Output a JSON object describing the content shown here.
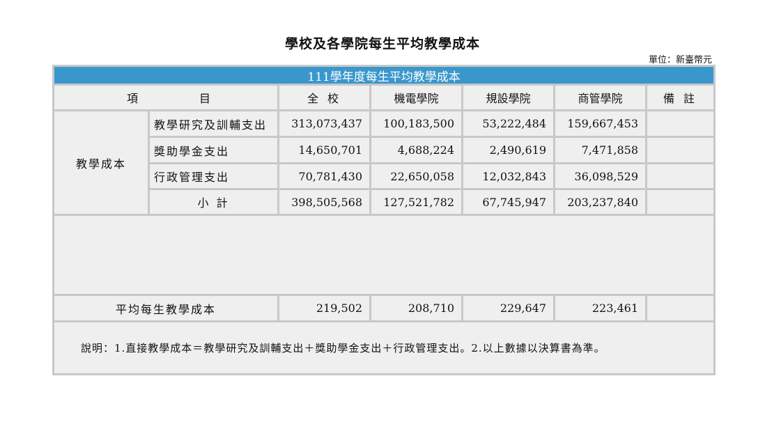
{
  "title": "學校及各學院每生平均教學成本",
  "unit": "單位：新臺幣元",
  "banner": "111學年度每生平均教學成本",
  "headers": {
    "item_left": "項",
    "item_right": "目",
    "school": "全 校",
    "college1": "機電學院",
    "college2": "規設學院",
    "college3": "商管學院",
    "remark": "備 註"
  },
  "group_label": "教學成本",
  "rows": [
    {
      "label": "教學研究及訓輔支出",
      "school": "313,073,437",
      "c1": "100,183,500",
      "c2": "53,222,484",
      "c3": "159,667,453",
      "remark": ""
    },
    {
      "label": "獎助學金支出",
      "school": "14,650,701",
      "c1": "4,688,224",
      "c2": "2,490,619",
      "c3": "7,471,858",
      "remark": ""
    },
    {
      "label": "行政管理支出",
      "school": "70,781,430",
      "c1": "22,650,058",
      "c2": "12,032,843",
      "c3": "36,098,529",
      "remark": ""
    },
    {
      "label": "小 計",
      "school": "398,505,568",
      "c1": "127,521,782",
      "c2": "67,745,947",
      "c3": "203,237,840",
      "remark": ""
    }
  ],
  "average": {
    "label": "平均每生教學成本",
    "school": "219,502",
    "c1": "208,710",
    "c2": "229,647",
    "c3": "223,461",
    "remark": ""
  },
  "note": "說明：1.直接教學成本＝教學研究及訓輔支出＋獎助學金支出＋行政管理支出。2.以上數據以決算書為準。",
  "colors": {
    "banner": "#3a97cc",
    "cell": "#efefef",
    "grid": "#c8c8c8"
  }
}
